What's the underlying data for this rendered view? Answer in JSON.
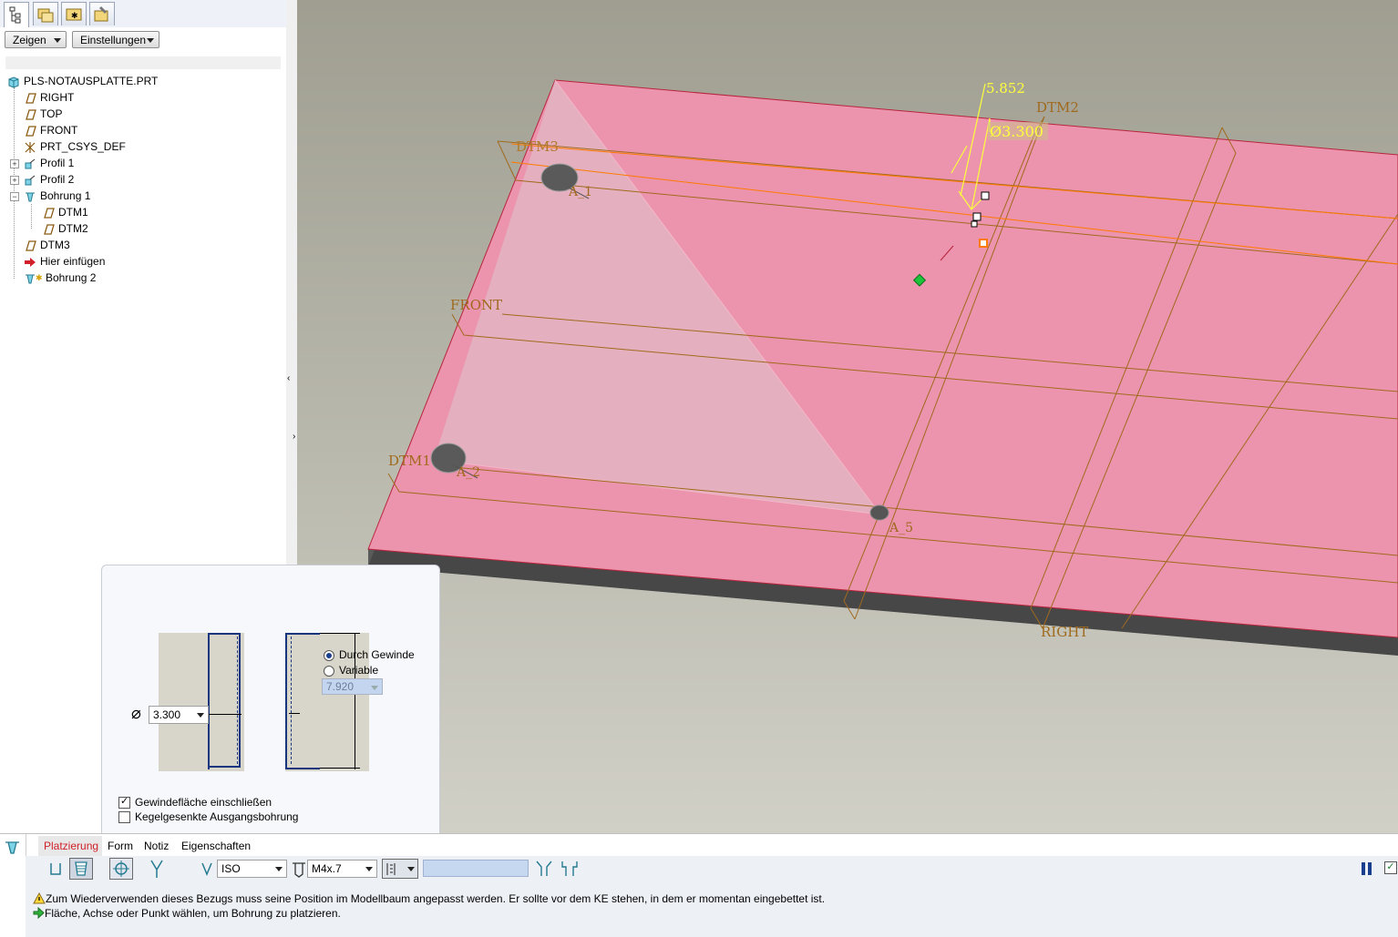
{
  "tree": {
    "show_label": "Zeigen",
    "settings_label": "Einstellungen",
    "root": "PLS-NOTAUSPLATTE.PRT",
    "items": [
      "RIGHT",
      "TOP",
      "FRONT",
      "PRT_CSYS_DEF",
      "Profil 1",
      "Profil 2",
      "Bohrung 1",
      "DTM1",
      "DTM2",
      "DTM3",
      "Hier einfügen",
      "Bohrung 2"
    ]
  },
  "viewport": {
    "dim_distance": "5.852",
    "dim_diameter": "Ø3.300",
    "labels": {
      "dtm1": "DTM1",
      "dtm2": "DTM2",
      "dtm3": "DTM3",
      "front": "FRONT",
      "right": "RIGHT",
      "a1": "A_1",
      "a2": "A_2",
      "a5": "A_5"
    },
    "colors": {
      "plate": "#ec93ad",
      "datum": "#a06a1e",
      "dimension": "#ffff3c",
      "background": "#b3b2a6"
    }
  },
  "form_dialog": {
    "diameter_value": "3.300",
    "radio_through": "Durch Gewinde",
    "radio_variable": "Variable",
    "depth_value": "7.920",
    "check_thread_surface": "Gewindefläche einschließen",
    "check_countersink": "Kegelgesenkte Ausgangsbohrung",
    "thread_surface_checked": true,
    "countersink_checked": false,
    "through_selected": true
  },
  "dashboard": {
    "tabs": [
      "Platzierung",
      "Form",
      "Notiz",
      "Eigenschaften"
    ],
    "active_tab": "Platzierung",
    "standard": "ISO",
    "screw_size": "M4x.7",
    "messages": [
      "Zum Wiederverwenden dieses Bezugs muss seine Position im Modellbaum angepasst werden. Er sollte vor dem KE stehen, in dem er momentan eingebettet ist.",
      "Fläche, Achse oder Punkt wählen, um Bohrung zu platzieren."
    ]
  }
}
